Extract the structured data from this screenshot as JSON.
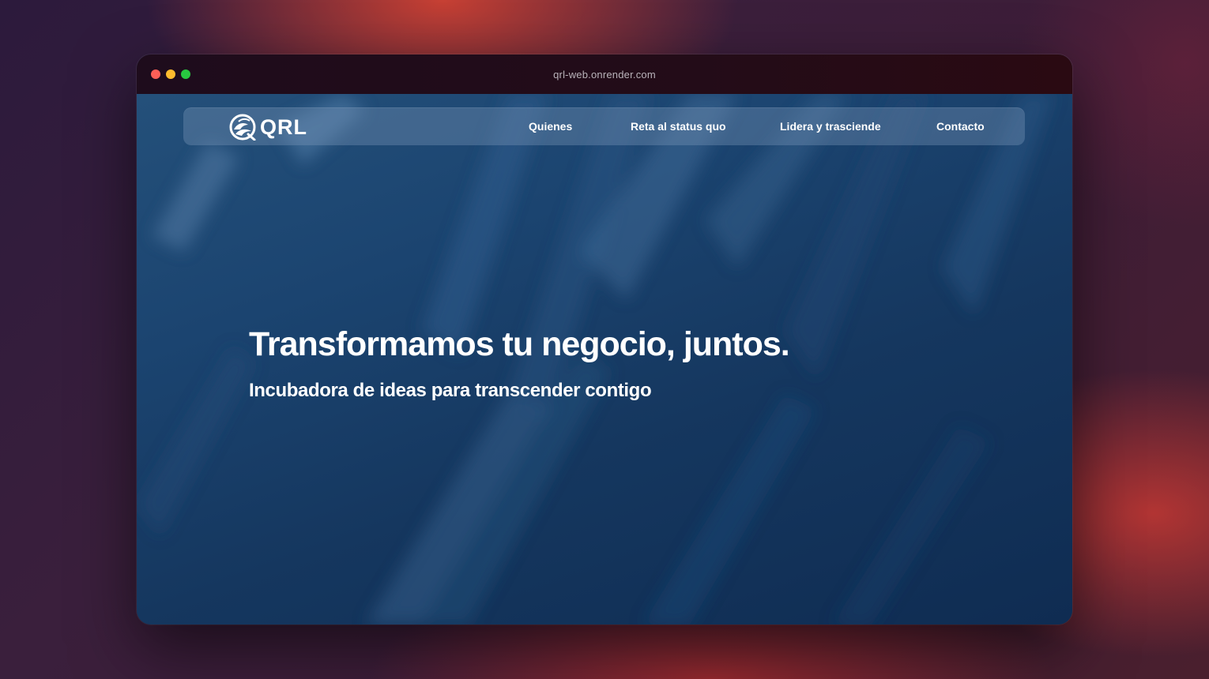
{
  "browser": {
    "url": "qrl-web.onrender.com"
  },
  "site": {
    "logo_text": "QRL",
    "nav": [
      {
        "label": "Quienes"
      },
      {
        "label": "Reta al status quo"
      },
      {
        "label": "Lidera y trasciende"
      },
      {
        "label": "Contacto"
      }
    ]
  },
  "hero": {
    "title": "Transformamos tu negocio, juntos.",
    "subtitle": "Incubadora de ideas para transcender contigo"
  },
  "colors": {
    "page_background": "#15375f",
    "navbar": "#7896b9",
    "close": "#fe5f57",
    "minimize": "#febc2e",
    "maximize": "#28c840"
  },
  "icons": {
    "logo": "qrl-wave-logo-icon"
  }
}
